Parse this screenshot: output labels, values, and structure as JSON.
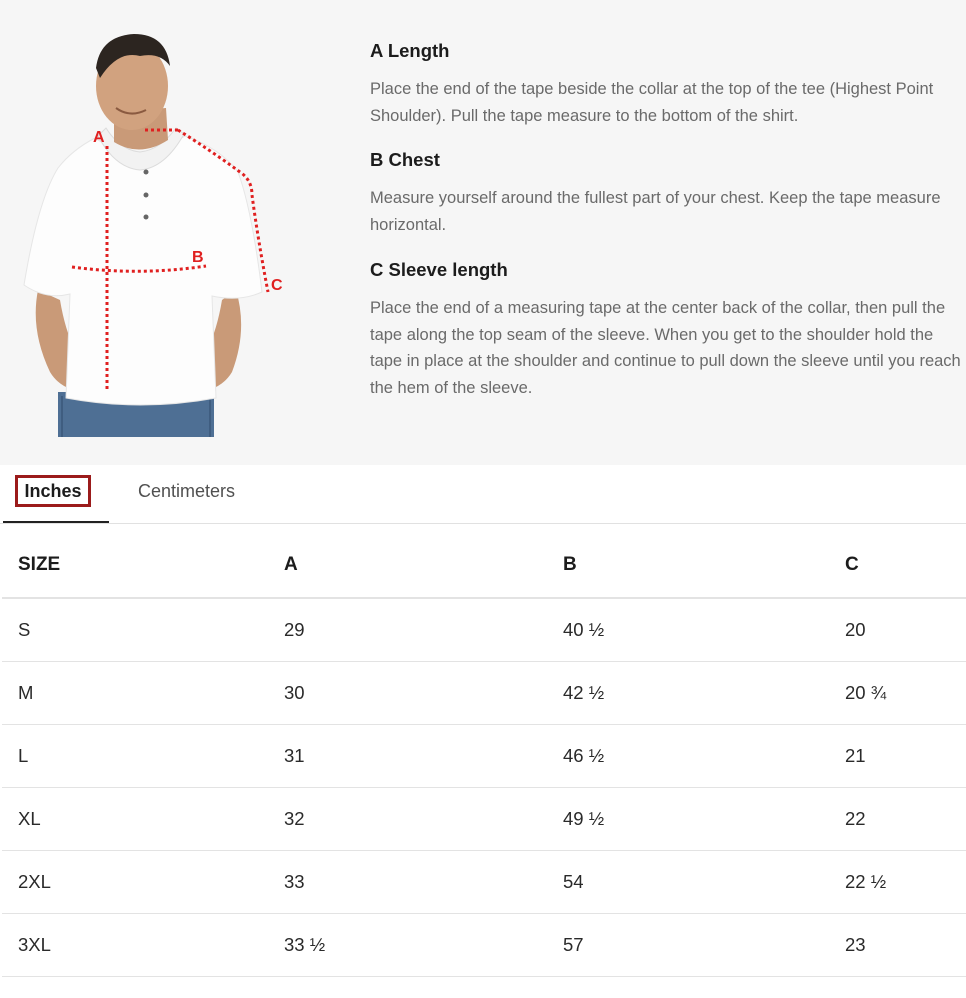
{
  "guide": {
    "labels": {
      "a": "A",
      "b": "B",
      "c": "C"
    },
    "items": [
      {
        "title": "A Length",
        "body": "Place the end of the tape beside the collar at the top of the tee (Highest Point Shoulder). Pull the tape measure to the bottom of the shirt."
      },
      {
        "title": "B Chest",
        "body": "Measure yourself around the fullest part of your chest. Keep the tape measure horizontal."
      },
      {
        "title": "C Sleeve length",
        "body": "Place the end of a measuring tape at the center back of the collar, then pull the tape along the top seam of the sleeve. When you get to the shoulder hold the tape in place at the shoulder and continue to pull down the sleeve until you reach the hem of the sleeve."
      }
    ]
  },
  "tabs": {
    "inches": "Inches",
    "centimeters": "Centimeters",
    "active": "inches"
  },
  "table": {
    "headers": [
      "SIZE",
      "A",
      "B",
      "C"
    ],
    "rows": [
      [
        "S",
        "29",
        "40 ½",
        "20"
      ],
      [
        "M",
        "30",
        "42 ½",
        "20 ¾"
      ],
      [
        "L",
        "31",
        "46 ½",
        "21"
      ],
      [
        "XL",
        "32",
        "49 ½",
        "22"
      ],
      [
        "2XL",
        "33",
        "54",
        "22 ½"
      ],
      [
        "3XL",
        "33 ½",
        "57",
        "23"
      ]
    ]
  },
  "colors": {
    "panel_background": "#f6f6f6",
    "tape_red": "#e02020",
    "active_tab_border": "#9b1b1b"
  }
}
